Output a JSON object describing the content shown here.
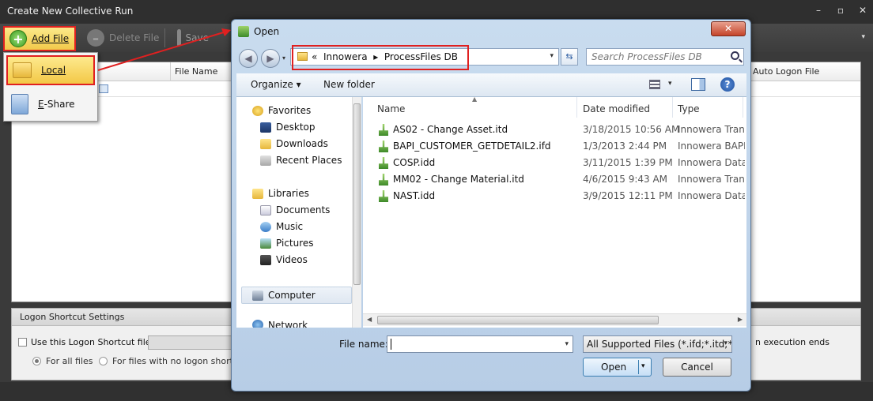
{
  "app": {
    "title": "Create New Collective Run",
    "window_buttons": [
      "–",
      "▫",
      "✕"
    ],
    "toolbar": {
      "add_file": "Add File",
      "delete_file": "Delete File",
      "save": "Save"
    },
    "grid": {
      "columns": [
        "File Name",
        "Auto Logon File"
      ]
    },
    "logon": {
      "legend": "Logon Shortcut Settings",
      "use_checkbox": "Use this Logon Shortcut file :",
      "radio_all": "For all files",
      "radio_nologon": "For files with no logon shortcut",
      "exec_ends": "n execution ends"
    }
  },
  "popup": {
    "local": "Local",
    "eshare": "E-Share"
  },
  "dialog": {
    "title": "Open",
    "close": "✕",
    "address": {
      "prefix": "«",
      "segments": [
        "Innowera",
        "ProcessFiles DB"
      ],
      "separator": "▸"
    },
    "search_placeholder": "Search ProcessFiles DB",
    "commands": {
      "organize": "Organize ▾",
      "new_folder": "New folder"
    },
    "nav": {
      "favorites": "Favorites",
      "desktop": "Desktop",
      "downloads": "Downloads",
      "recent": "Recent Places",
      "libraries": "Libraries",
      "documents": "Documents",
      "music": "Music",
      "pictures": "Pictures",
      "videos": "Videos",
      "computer": "Computer",
      "network": "Network"
    },
    "columns": {
      "name": "Name",
      "date": "Date modified",
      "type": "Type"
    },
    "files": [
      {
        "name": "AS02 - Change Asset.itd",
        "date": "3/18/2015 10:56 AM",
        "type": "Innowera Transa"
      },
      {
        "name": "BAPI_CUSTOMER_GETDETAIL2.ifd",
        "date": "1/3/2013 2:44 PM",
        "type": "Innowera BAPI/F"
      },
      {
        "name": "COSP.idd",
        "date": "3/11/2015 1:39 PM",
        "type": "Innowera Data E"
      },
      {
        "name": "MM02 - Change Material.itd",
        "date": "4/6/2015 9:43 AM",
        "type": "Innowera Transa"
      },
      {
        "name": "NAST.idd",
        "date": "3/9/2015 12:11 PM",
        "type": "Innowera Data E"
      }
    ],
    "file_name_label": "File name:",
    "file_name_value": "",
    "file_type": "All Supported Files (*.ifd;*.itd;*.",
    "open_label": "Open",
    "cancel_label": "Cancel"
  }
}
